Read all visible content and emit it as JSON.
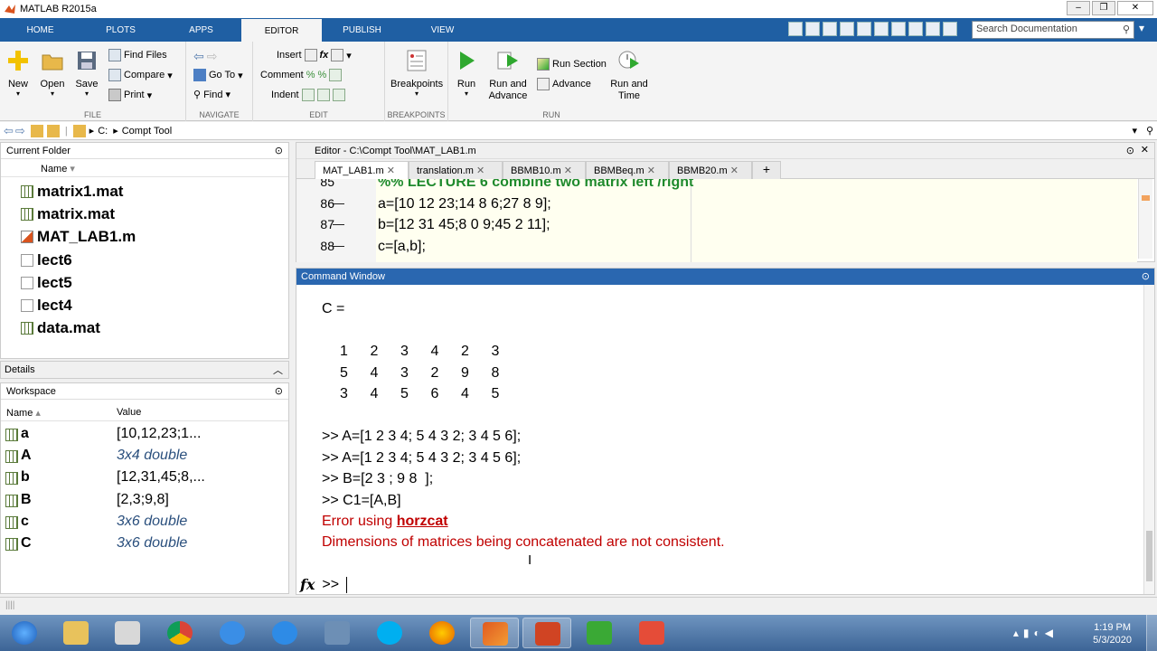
{
  "window": {
    "title": "MATLAB R2015a"
  },
  "ribbon_tabs": [
    "HOME",
    "PLOTS",
    "APPS",
    "EDITOR",
    "PUBLISH",
    "VIEW"
  ],
  "search": {
    "placeholder": "Search Documentation"
  },
  "ribbon": {
    "file": {
      "label": "FILE",
      "new": "New",
      "open": "Open",
      "save": "Save",
      "find_files": "Find Files",
      "compare": "Compare",
      "print": "Print"
    },
    "navigate": {
      "label": "NAVIGATE",
      "go_to": "Go To",
      "find": "Find"
    },
    "edit": {
      "label": "EDIT",
      "insert": "Insert",
      "comment": "Comment",
      "indent": "Indent",
      "fx": "fx"
    },
    "breakpoints": {
      "label": "BREAKPOINTS",
      "breakpoints": "Breakpoints"
    },
    "run": {
      "label": "RUN",
      "run": "Run",
      "run_and_advance": "Run and Advance",
      "run_section": "Run Section",
      "advance": "Advance",
      "run_and_time": "Run and Time"
    }
  },
  "path": {
    "drive": "C:",
    "folder": "Compt Tool"
  },
  "current_folder": {
    "title": "Current Folder",
    "column": "Name",
    "files": [
      {
        "name": "matrix1.mat",
        "icon": "mat-file-icon"
      },
      {
        "name": "matrix.mat",
        "icon": "mat-file-icon"
      },
      {
        "name": "MAT_LAB1.m",
        "icon": "m-file-icon"
      },
      {
        "name": "lect6",
        "icon": "file-icon"
      },
      {
        "name": "lect5",
        "icon": "file-icon"
      },
      {
        "name": "lect4",
        "icon": "file-icon"
      },
      {
        "name": "data.mat",
        "icon": "mat-file-icon"
      }
    ]
  },
  "details": {
    "title": "Details"
  },
  "workspace": {
    "title": "Workspace",
    "col_name": "Name",
    "col_value": "Value",
    "vars": [
      {
        "name": "a",
        "value": "[10,12,23;1...",
        "italic": false
      },
      {
        "name": "A",
        "value": "3x4 double",
        "italic": true
      },
      {
        "name": "b",
        "value": "[12,31,45;8,...",
        "italic": false
      },
      {
        "name": "B",
        "value": "[2,3;9,8]",
        "italic": false
      },
      {
        "name": "c",
        "value": "3x6 double",
        "italic": true
      },
      {
        "name": "C",
        "value": "3x6 double",
        "italic": true
      }
    ]
  },
  "editor": {
    "title": "Editor - C:\\Compt Tool\\MAT_LAB1.m",
    "tabs": [
      "MAT_LAB1.m",
      "translation.m",
      "BBMB10.m",
      "BBMBeq.m",
      "BBMB20.m"
    ],
    "lines": [
      {
        "num": "85",
        "text": "%% LECTURE 6 combine two matrix  left /right",
        "cell": true
      },
      {
        "num": "86",
        "text": "a=[10 12 23;14 8 6;27 8 9];",
        "cell": false
      },
      {
        "num": "87",
        "text": "b=[12 31 45;8  0 9;45 2 11];",
        "cell": false
      },
      {
        "num": "88",
        "text": "c=[a,b];",
        "cell": false
      }
    ]
  },
  "command_window": {
    "title": "Command Window",
    "var_header": "C =",
    "matrix": [
      [
        "1",
        "2",
        "3",
        "4",
        "2",
        "3"
      ],
      [
        "5",
        "4",
        "3",
        "2",
        "9",
        "8"
      ],
      [
        "3",
        "4",
        "5",
        "6",
        "4",
        "5"
      ]
    ],
    "commands": [
      ">> A=[1 2 3 4; 5 4 3 2; 3 4 5 6];",
      ">> A=[1 2 3 4; 5 4 3 2; 3 4 5 6];",
      ">> B=[2 3 ; 9 8  ];",
      ">> C1=[A,B]"
    ],
    "error_prefix": "Error using ",
    "error_fn": "horzcat",
    "error_msg": "Dimensions of matrices being concatenated are not consistent.",
    "prompt": ">>",
    "fx": "fx"
  },
  "taskbar": {
    "time": "1:19 PM",
    "date": "5/3/2020"
  },
  "colors": {
    "accent": "#1f5fa3",
    "error": "#c00000",
    "cell_title": "#1f8a2d",
    "editor_bg": "#fffff0"
  }
}
